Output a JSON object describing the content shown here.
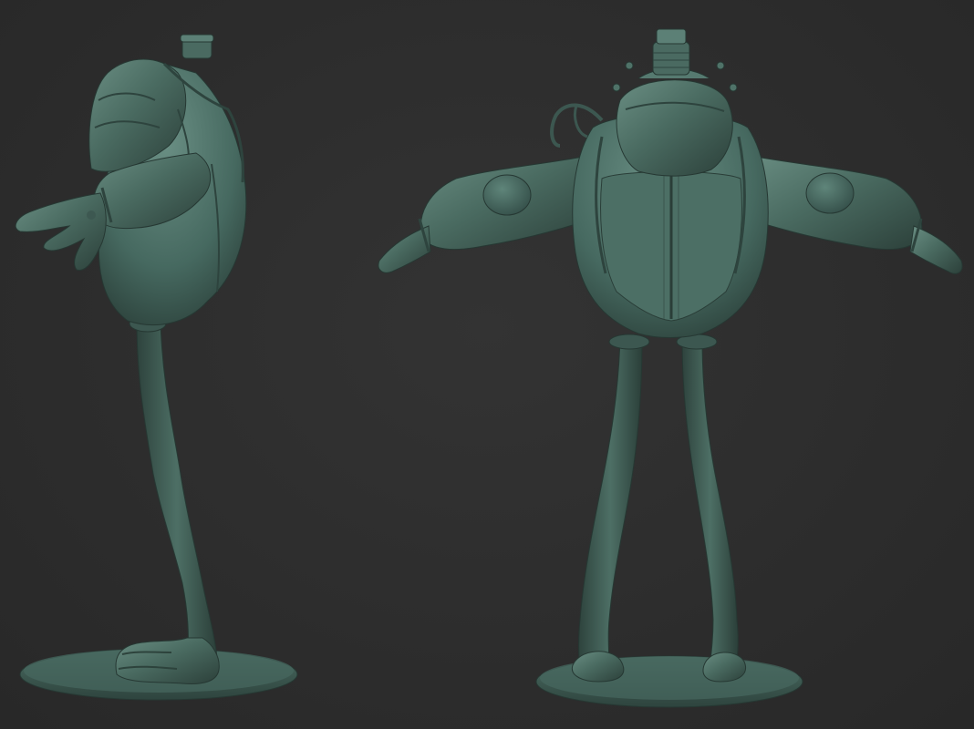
{
  "scene": {
    "background_color": "#2c2c2c",
    "model_color": "#4a6a60",
    "views": [
      "side",
      "back"
    ]
  }
}
